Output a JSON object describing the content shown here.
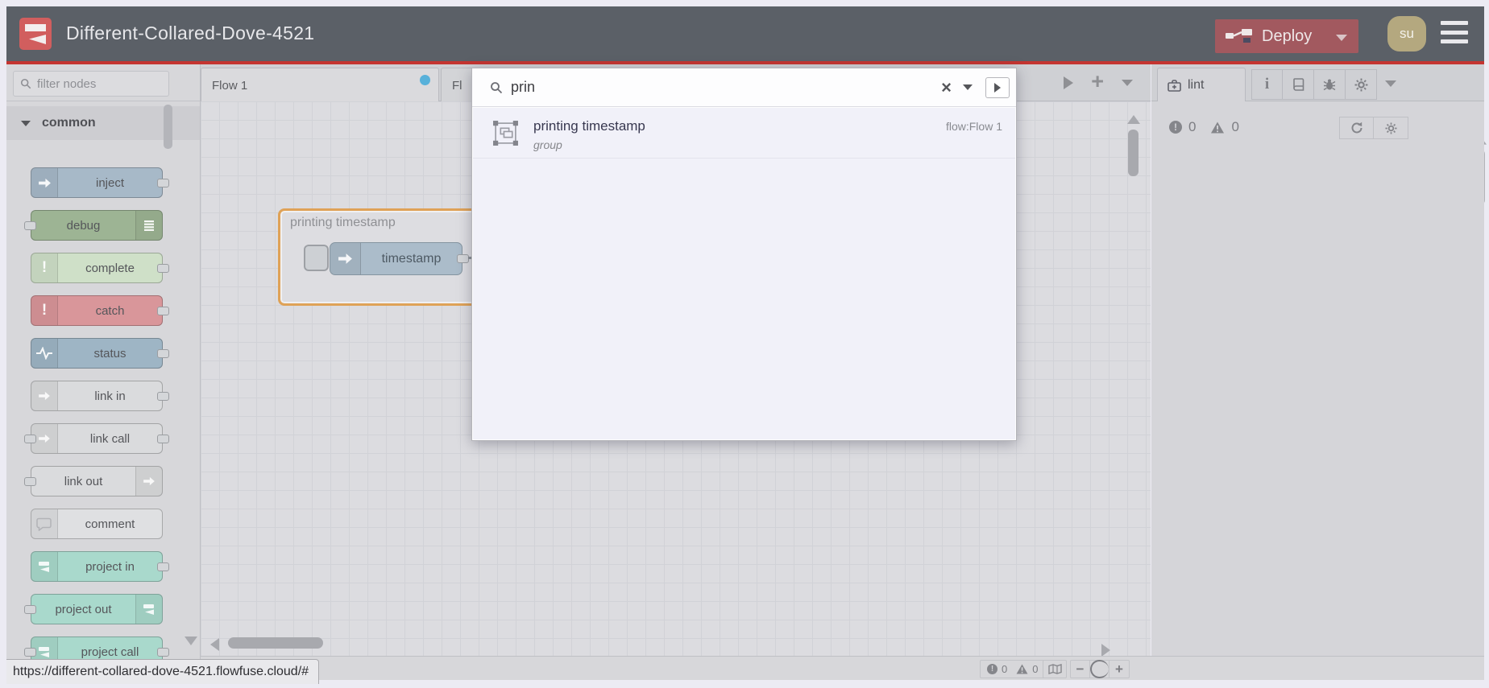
{
  "header": {
    "title": "Different-Collared-Dove-4521",
    "deploy_label": "Deploy",
    "avatar_initials": "su",
    "colors": {
      "bar": "#5b6067",
      "accent_line": "#c43531",
      "deploy_bg": "#a2595f",
      "avatar_bg": "#b4a87f",
      "logo_red": "#d15e5e"
    }
  },
  "palette": {
    "filter_placeholder": "filter nodes",
    "category": {
      "label": "common"
    },
    "nodes": [
      {
        "label": "inject",
        "color": "#a7b9c8",
        "icon": "inject-arrow-icon",
        "icon_side": "left",
        "ports": "right"
      },
      {
        "label": "debug",
        "color": "#9db494",
        "icon": "debug-list-icon",
        "icon_side": "right",
        "ports": "left"
      },
      {
        "label": "complete",
        "color": "#cfe0c8",
        "icon": "exclamation-icon",
        "icon_side": "left",
        "ports": "right"
      },
      {
        "label": "catch",
        "color": "#d9969a",
        "icon": "exclamation-icon",
        "icon_side": "left",
        "ports": "right"
      },
      {
        "label": "status",
        "color": "#9eb5c5",
        "icon": "status-pulse-icon",
        "icon_side": "left",
        "ports": "right"
      },
      {
        "label": "link in",
        "color": "#dadbdd",
        "icon": "link-arrow-icon",
        "icon_side": "left",
        "ports": "right"
      },
      {
        "label": "link call",
        "color": "#dadbdd",
        "icon": "link-arrow-icon",
        "icon_side": "left",
        "ports": "both"
      },
      {
        "label": "link out",
        "color": "#dadbdd",
        "icon": "link-arrow-icon",
        "icon_side": "right",
        "ports": "left"
      },
      {
        "label": "comment",
        "color": "#dfe0e2",
        "icon": "comment-bubble-icon",
        "icon_side": "left",
        "ports": "none"
      },
      {
        "label": "project in",
        "color": "#a9d9cc",
        "icon": "project-logo-icon",
        "icon_side": "left",
        "ports": "right"
      },
      {
        "label": "project out",
        "color": "#a9d9cc",
        "icon": "project-logo-icon",
        "icon_side": "right",
        "ports": "left"
      },
      {
        "label": "project call",
        "color": "#a9d9cc",
        "icon": "project-logo-icon",
        "icon_side": "left",
        "ports": "both"
      }
    ]
  },
  "workspace": {
    "tabs": [
      {
        "label": "Flow 1",
        "active": true,
        "dirty": true,
        "dot_color": "#58b1da"
      },
      {
        "label": "Fl",
        "active": false,
        "dirty": false
      }
    ],
    "toolbar": {
      "add_label": "+"
    }
  },
  "canvas": {
    "group": {
      "label": "printing timestamp",
      "border_color": "#dfa257"
    },
    "node": {
      "label": "timestamp",
      "color": "#abbcca"
    }
  },
  "search": {
    "query": "prin",
    "clear_glyph": "×",
    "results": [
      {
        "title": "printing timestamp",
        "subtitle": "group",
        "location": "flow:Flow 1",
        "icon": "group-icon"
      }
    ]
  },
  "sidebar": {
    "tab": {
      "label": "lint"
    },
    "toolbar": {
      "info_glyph": "i"
    },
    "counts": {
      "errors": "0",
      "warnings": "0"
    }
  },
  "footer": {
    "counts": {
      "errors": "0",
      "warnings": "0"
    },
    "zoom": {
      "minus": "−",
      "plus": "+"
    }
  },
  "status_bar": {
    "url": "https://different-collared-dove-4521.flowfuse.cloud/#"
  }
}
